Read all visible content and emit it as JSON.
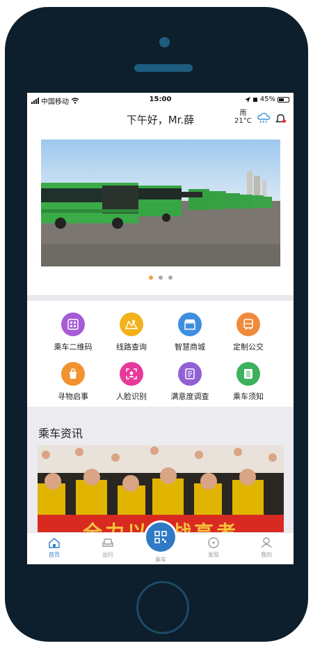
{
  "status_bar": {
    "carrier": "中国移动",
    "time": "15:00",
    "battery": "45%"
  },
  "header": {
    "greeting": "下午好，Mr.薛",
    "weather_condition": "雨",
    "temperature": "21°C"
  },
  "banner": {
    "total_slides": 3,
    "active_slide": 1
  },
  "services": [
    {
      "label": "乘车二维码",
      "icon": "qr-code-icon",
      "color": "#a55cd6"
    },
    {
      "label": "线路查询",
      "icon": "map-route-icon",
      "color": "#f3b21c"
    },
    {
      "label": "智慧商城",
      "icon": "shop-icon",
      "color": "#3f8fe0"
    },
    {
      "label": "定制公交",
      "icon": "bus-icon",
      "color": "#f08a3c"
    },
    {
      "label": "寻物启事",
      "icon": "lost-found-icon",
      "color": "#f29231"
    },
    {
      "label": "人脸识别",
      "icon": "face-recognition-icon",
      "color": "#e8389a"
    },
    {
      "label": "满意度调查",
      "icon": "survey-icon",
      "color": "#9161d4"
    },
    {
      "label": "乘车须知",
      "icon": "notice-icon",
      "color": "#3cb15e"
    }
  ],
  "news": {
    "section_title": "乘车资讯",
    "banner_text": "全力以赴战高考"
  },
  "tabbar": {
    "home": "首页",
    "travel": "出行",
    "ride": "乘车",
    "discover": "发现",
    "mine": "我的"
  },
  "colors": {
    "accent": "#2f79c5",
    "phone_body": "#0d1f2c"
  }
}
